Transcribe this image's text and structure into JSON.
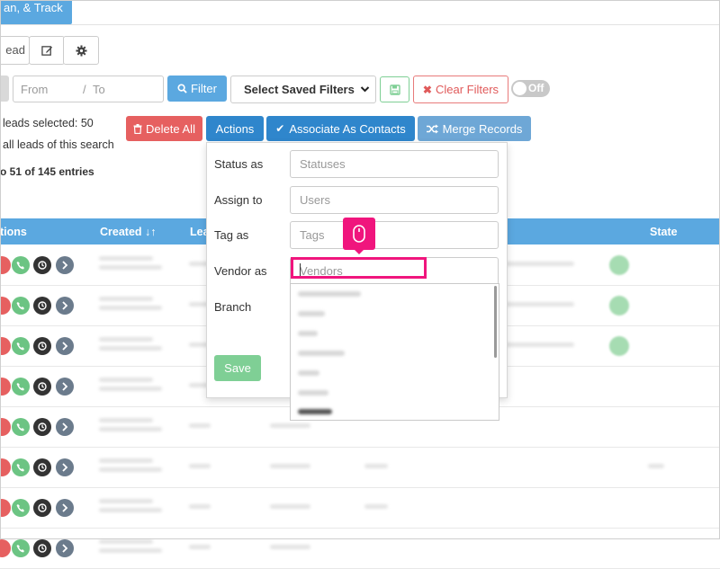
{
  "top_tab": {
    "label": "an, & Track"
  },
  "toolbar": {
    "lead_label": "ead",
    "edit_icon": "edit-icon",
    "settings_icon": "gear-icon"
  },
  "filters": {
    "from_placeholder": "From",
    "separator": "/",
    "to_placeholder": "To",
    "filter_label": "Filter",
    "saved_filters_label": "Select Saved Filters",
    "clear_label": "Clear Filters",
    "toggle_label": "Off"
  },
  "selection": {
    "leads_selected": "leads selected: 50",
    "all_leads": "all leads of this search",
    "entries": "o 51 of 145 entries"
  },
  "bulk_actions": {
    "delete_all": "Delete All",
    "actions": "Actions",
    "associate": "Associate As Contacts",
    "merge": "Merge Records"
  },
  "table": {
    "headers": {
      "actions": "tions",
      "created": "Created",
      "lead": "Lea",
      "state": "State"
    },
    "row_count": 8
  },
  "actions_panel": {
    "status_label": "Status as",
    "status_placeholder": "Statuses",
    "assign_label": "Assign to",
    "assign_placeholder": "Users",
    "tag_label": "Tag as",
    "tag_placeholder": "Tags",
    "vendor_label": "Vendor as",
    "vendor_placeholder": "Vendors",
    "branch_label": "Branch",
    "save_label": "Save"
  },
  "colors": {
    "primary": "#2f86cc",
    "header_blue": "#5ba8e0",
    "danger": "#e66060",
    "success": "#7fcf95",
    "highlight": "#f0157d"
  }
}
